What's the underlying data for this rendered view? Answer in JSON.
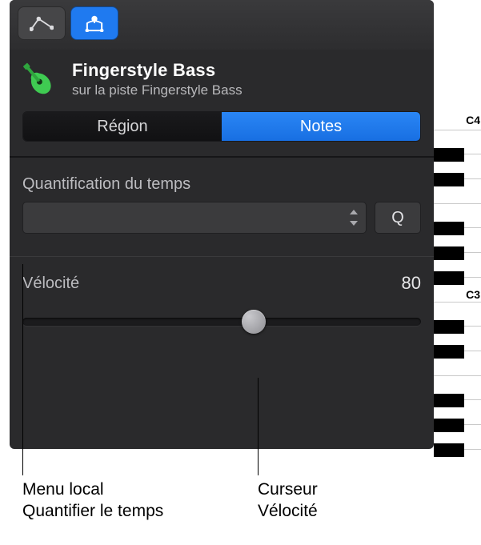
{
  "toolbar": {
    "automation_name": "automation-tool-icon",
    "midifork_name": "midi-draw-icon"
  },
  "header": {
    "title": "Fingerstyle Bass",
    "subtitle": "sur la piste Fingerstyle Bass",
    "instrument_icon": "guitar-icon"
  },
  "segmented": {
    "region_label": "Région",
    "notes_label": "Notes"
  },
  "quantize": {
    "section_label": "Quantification du temps",
    "dropdown_value": "",
    "apply_button": "Q"
  },
  "velocity": {
    "label": "Vélocité",
    "value": "80"
  },
  "piano": {
    "label_c4": "C4",
    "label_c3": "C3"
  },
  "callouts": {
    "left_line1": "Menu local",
    "left_line2": "Quantifier le temps",
    "right_line1": "Curseur",
    "right_line2": "Vélocité"
  }
}
